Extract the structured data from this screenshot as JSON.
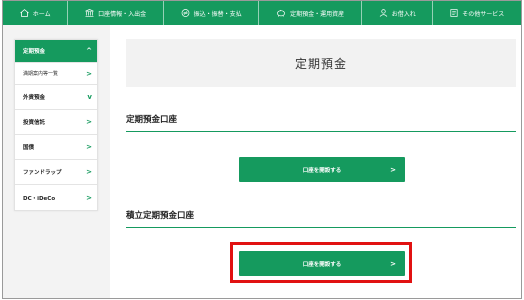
{
  "nav": {
    "items": [
      {
        "label": "ホーム",
        "icon": "home-icon"
      },
      {
        "label": "口座情報・入出金",
        "icon": "bank-icon"
      },
      {
        "label": "振込・振替・支払",
        "icon": "transfer-icon"
      },
      {
        "label": "定期預金・運用資産",
        "icon": "piggy-bank-icon"
      },
      {
        "label": "お借入れ",
        "icon": "loan-icon"
      },
      {
        "label": "その他サービス",
        "icon": "services-icon"
      }
    ]
  },
  "sidebar": {
    "items": [
      {
        "label": "定期預金",
        "chevron": "^"
      },
      {
        "label": "満期案内等一覧",
        "chevron": ">"
      },
      {
        "label": "外貨預金",
        "chevron": "v"
      },
      {
        "label": "投資信託",
        "chevron": ">"
      },
      {
        "label": "国債",
        "chevron": ">"
      },
      {
        "label": "ファンドラップ",
        "chevron": ">"
      },
      {
        "label": "DC・iDeCo",
        "chevron": ">"
      }
    ]
  },
  "main": {
    "title": "定期預金",
    "section1": {
      "heading": "定期預金口座",
      "button_label": "口座を開設する",
      "button_chevron": ">"
    },
    "section2": {
      "heading": "積立定期預金口座",
      "button_label": "口座を開設する",
      "button_chevron": ">"
    }
  },
  "colors": {
    "brand_green": "#159a5e",
    "highlight_red": "#e11111"
  }
}
